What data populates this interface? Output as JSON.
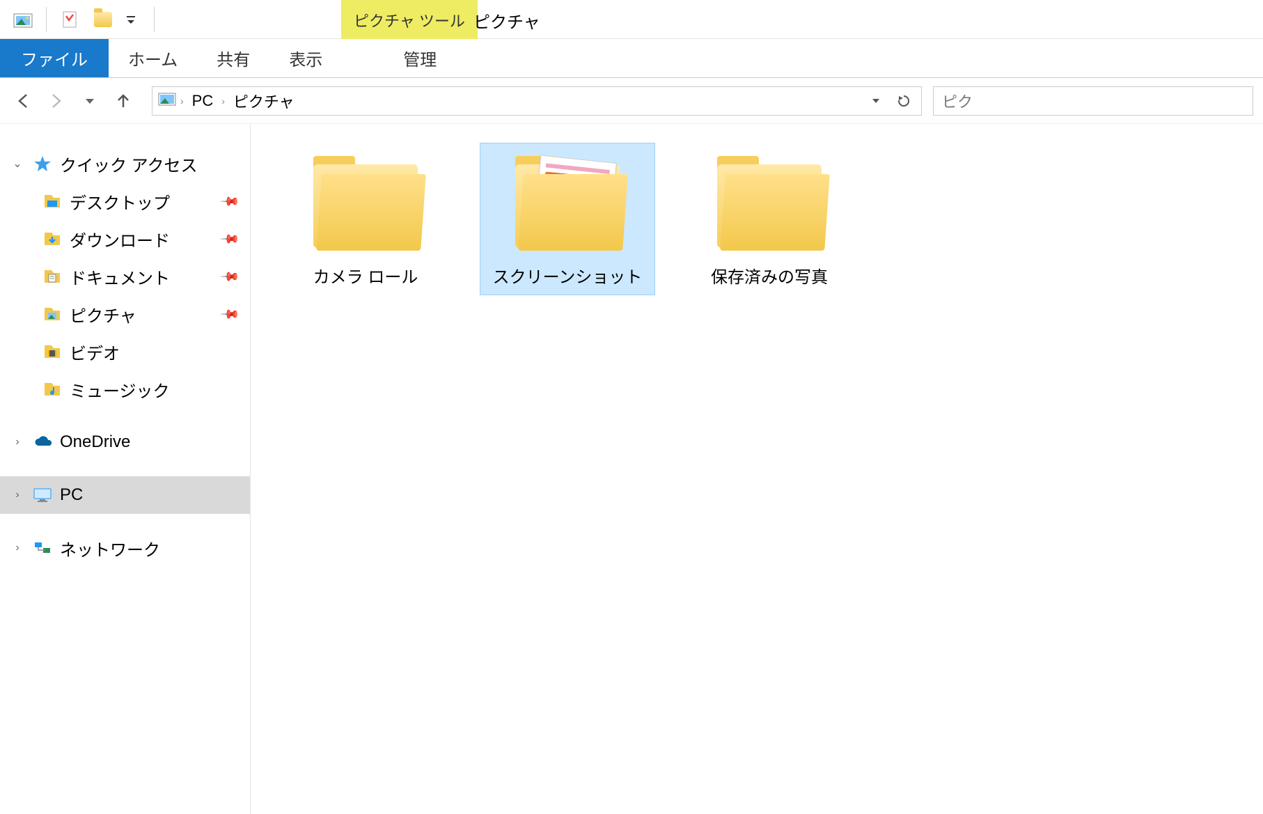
{
  "window": {
    "context_tab": "ピクチャ ツール",
    "title": "ピクチャ"
  },
  "ribbon": {
    "file": "ファイル",
    "home": "ホーム",
    "share": "共有",
    "view": "表示",
    "manage": "管理"
  },
  "breadcrumb": {
    "pc": "PC",
    "pictures": "ピクチャ"
  },
  "search": {
    "placeholder": "ピク"
  },
  "sidebar": {
    "quick_access": "クイック アクセス",
    "items": [
      {
        "label": "デスクトップ",
        "pinned": true
      },
      {
        "label": "ダウンロード",
        "pinned": true
      },
      {
        "label": "ドキュメント",
        "pinned": true
      },
      {
        "label": "ピクチャ",
        "pinned": true
      },
      {
        "label": "ビデオ",
        "pinned": false
      },
      {
        "label": "ミュージック",
        "pinned": false
      }
    ],
    "onedrive": "OneDrive",
    "pc": "PC",
    "network": "ネットワーク"
  },
  "folders": [
    {
      "label": "カメラ ロール",
      "selected": false,
      "has_preview": false
    },
    {
      "label": "スクリーンショット",
      "selected": true,
      "has_preview": true
    },
    {
      "label": "保存済みの写真",
      "selected": false,
      "has_preview": false
    }
  ]
}
